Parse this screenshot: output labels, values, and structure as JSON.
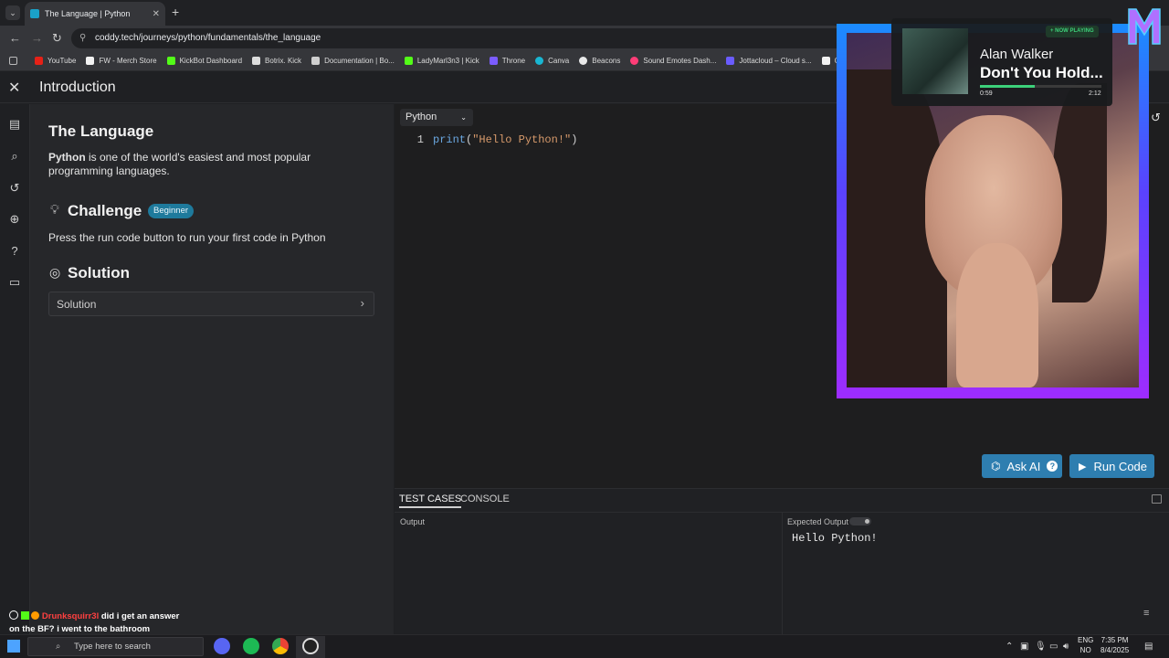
{
  "browser": {
    "tab_title": "The Language | Python",
    "url": "coddy.tech/journeys/python/fundamentals/the_language",
    "bookmarks": [
      "YouTube",
      "FW - Merch Store",
      "KickBot Dashboard",
      "Botrix. Kick",
      "Documentation | Bo...",
      "LadyMarl3n3 | Kick",
      "Throne",
      "Canva",
      "Beacons",
      "Sound Emotes Dash...",
      "Jottacloud – Cloud s...",
      "Co"
    ]
  },
  "app": {
    "header_title": "Introduction",
    "section_title": "The Language",
    "intro_bold": "Python",
    "intro_rest": " is one of the world's easiest and most popular programming languages.",
    "challenge_title": "Challenge",
    "challenge_badge": "Beginner",
    "challenge_text": "Press the run code button to run your first code in Python",
    "solution_title": "Solution",
    "solution_dropdown": "Solution"
  },
  "editor": {
    "language": "Python",
    "line_number": "1",
    "code_fn": "print",
    "code_open": "(",
    "code_str": "\"Hello Python!\"",
    "code_close": ")",
    "ask_ai_label": "Ask AI",
    "run_label": "Run Code"
  },
  "bottom": {
    "tab_tests": "TEST CASES",
    "tab_console": "CONSOLE",
    "output_label": "Output",
    "expected_label": "Expected Output",
    "expected_value": "Hello Python!"
  },
  "overlay": {
    "now_playing_tag": "+ NOW PLAYING",
    "artist": "Alan Walker",
    "song": "Don't You Hold...",
    "elapsed": "0:59",
    "duration": "2:12",
    "progress_fraction": 0.45
  },
  "chat": {
    "user": "Drunksquirr3l",
    "message": " did i get an answer on the BF? i went to the bathroom"
  },
  "taskbar": {
    "search_placeholder": "Type here to search",
    "lang_1": "ENG",
    "lang_2": "NO",
    "time": "7:35 PM",
    "date": "8/4/2025"
  },
  "colors": {
    "accent": "#2e7eb0",
    "badge": "#1e7a9c",
    "now_playing_green": "#3cd07a",
    "chat_user": "#ff4040"
  }
}
